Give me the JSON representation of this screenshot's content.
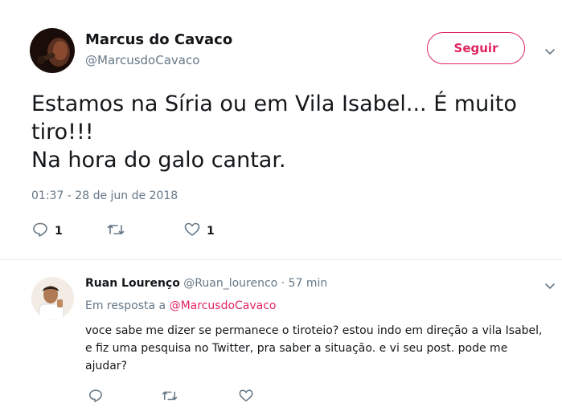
{
  "main_tweet": {
    "author_name": "Marcus do Cavaco",
    "author_handle": "@MarcusdoCavaco",
    "follow_label": "Seguir",
    "text_lines": [
      "Estamos na Síria ou em Vila Isabel... É muito",
      "tiro!!!",
      "Na hora do galo cantar."
    ],
    "timestamp": "01:37 - 28 de jun de 2018",
    "reply_count": "1",
    "like_count": "1"
  },
  "reply": {
    "author_name": "Ruan Lourenço",
    "meta": "@Ruan_lourenco · 57 min",
    "in_reply_prefix": "Em resposta a",
    "in_reply_mention": "@MarcusdoCavaco",
    "text_lines": [
      "voce sabe me dizer se permanece o tiroteio? estou indo em direção a vila Isabel,",
      "e fiz uma pesquisa no Twitter, pra saber a situação. e vi seu post. pode me",
      "ajudar?"
    ]
  },
  "icons": {
    "reply": "reply-icon",
    "retweet": "retweet-icon",
    "like": "heart-icon",
    "menu": "chevron-down-icon"
  },
  "colors": {
    "accent": "#e0245e",
    "secondary_text": "#657786",
    "icon": "#657786"
  }
}
